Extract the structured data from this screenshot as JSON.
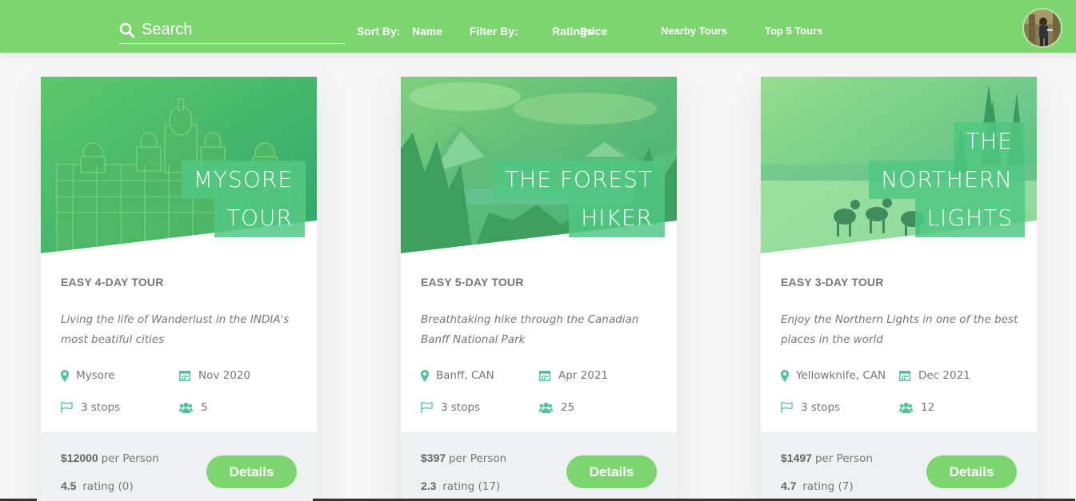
{
  "header": {
    "search_placeholder": "Search",
    "sort_label": "Sort By:",
    "sort_name": "Name",
    "filter_label": "Filter By:",
    "filter_ratings": "Ratings",
    "filter_price": "Price",
    "nearby_tours": "Nearby Tours",
    "top_tours": "Top 5 Tours"
  },
  "colors": {
    "brand_green": "#7dd56f",
    "accent_green": "#28b487",
    "footer_bg": "#edf1f1"
  },
  "cards": [
    {
      "title_lines": [
        "MYSORE",
        "TOUR"
      ],
      "subheading": "EASY 4-DAY TOUR",
      "summary": "Living the life of Wanderlust in the INDIA's most beatiful cities",
      "location": "Mysore",
      "date": "Nov 2020",
      "stops": "3 stops",
      "group_size": "5",
      "price": "$12000",
      "price_unit": "per Person",
      "rating": "4.5",
      "rating_label": "rating (0)",
      "button": "Details"
    },
    {
      "title_lines": [
        "THE FOREST",
        "HIKER"
      ],
      "subheading": "EASY 5-DAY TOUR",
      "summary": "Breathtaking hike through the Canadian Banff National Park",
      "location": "Banff, CAN",
      "date": "Apr 2021",
      "stops": "3 stops",
      "group_size": "25",
      "price": "$397",
      "price_unit": "per Person",
      "rating": "2.3",
      "rating_label": "rating (17)",
      "button": "Details"
    },
    {
      "title_lines": [
        "THE",
        "NORTHERN",
        "LIGHTS"
      ],
      "subheading": "EASY 3-DAY TOUR",
      "summary": "Enjoy the Northern Lights in one of the best places in the world",
      "location": "Yellowknife, CAN",
      "date": "Dec 2021",
      "stops": "3 stops",
      "group_size": "12",
      "price": "$1497",
      "price_unit": "per Person",
      "rating": "4.7",
      "rating_label": "rating (7)",
      "button": "Details"
    }
  ],
  "icons": [
    "search-icon",
    "map-pin-icon",
    "calendar-icon",
    "flag-icon",
    "users-icon"
  ]
}
